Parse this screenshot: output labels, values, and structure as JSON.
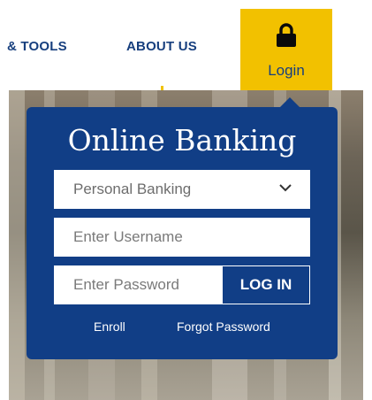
{
  "nav": {
    "tools_label": "& TOOLS",
    "about_label": "ABOUT US",
    "login_label": "Login",
    "login_icon": "lock-icon"
  },
  "banking": {
    "title": "Online Banking",
    "account_type": "Personal Banking",
    "username_placeholder": "Enter Username",
    "password_placeholder": "Enter Password",
    "login_button": "LOG IN",
    "enroll_label": "Enroll",
    "forgot_label": "Forgot Password"
  },
  "colors": {
    "brand_navy": "#113e86",
    "accent_gold": "#f2c100",
    "nav_text": "#173f7e"
  }
}
